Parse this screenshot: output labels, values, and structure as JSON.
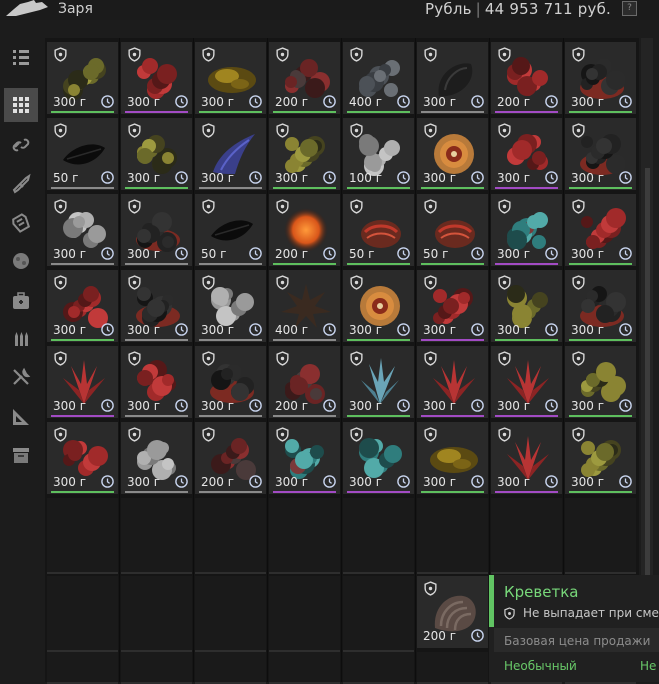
{
  "header": {
    "player_name": "Заря",
    "currency_label": "Рубль",
    "currency_amount": "44 953 711 руб.",
    "help_label": "?"
  },
  "sidebar": {
    "items": [
      {
        "name": "sidebar-item-all",
        "icon": "list-icon",
        "active": false
      },
      {
        "name": "sidebar-item-artifacts",
        "icon": "grid-icon",
        "active": true
      },
      {
        "name": "sidebar-item-containers",
        "icon": "chain-icon",
        "active": false
      },
      {
        "name": "sidebar-item-weapons",
        "icon": "rifle-icon",
        "active": false
      },
      {
        "name": "sidebar-item-armor",
        "icon": "armor-icon",
        "active": false
      },
      {
        "name": "sidebar-item-materials",
        "icon": "sphere-icon",
        "active": false
      },
      {
        "name": "sidebar-item-medicine",
        "icon": "medkit-icon",
        "active": false
      },
      {
        "name": "sidebar-item-ammo",
        "icon": "bullets-icon",
        "active": false
      },
      {
        "name": "sidebar-item-tools",
        "icon": "tools-icon",
        "active": false
      },
      {
        "name": "sidebar-item-drawing",
        "icon": "ruler-icon",
        "active": false
      },
      {
        "name": "sidebar-item-misc",
        "icon": "box-icon",
        "active": false
      }
    ]
  },
  "inventory": {
    "rows": [
      [
        {
          "weight": "300 г",
          "art": "yellow-cluster",
          "rarity": "uncommon"
        },
        {
          "weight": "300 г",
          "art": "red-cluster",
          "rarity": "rare"
        },
        {
          "weight": "300 г",
          "art": "gold-shell",
          "rarity": "uncommon"
        },
        {
          "weight": "200 г",
          "art": "red-rock",
          "rarity": "uncommon"
        },
        {
          "weight": "400 г",
          "art": "grey-cluster",
          "rarity": "uncommon"
        },
        {
          "weight": "300 г",
          "art": "black-shell",
          "rarity": "common"
        },
        {
          "weight": "200 г",
          "art": "red-cluster",
          "rarity": "rare"
        },
        {
          "weight": "300 г",
          "art": "black-red-cluster",
          "rarity": "uncommon"
        }
      ],
      [
        {
          "weight": "50 г",
          "art": "black-leaf",
          "rarity": "common"
        },
        {
          "weight": "300 г",
          "art": "yellow-cluster",
          "rarity": "uncommon"
        },
        {
          "weight": "300 г",
          "art": "blue-claw",
          "rarity": "common"
        },
        {
          "weight": "300 г",
          "art": "yellow-cluster",
          "rarity": "uncommon"
        },
        {
          "weight": "100 г",
          "art": "white-rose",
          "rarity": "uncommon"
        },
        {
          "weight": "300 г",
          "art": "orange-swirl",
          "rarity": "uncommon"
        },
        {
          "weight": "300 г",
          "art": "red-cluster",
          "rarity": "rare"
        },
        {
          "weight": "300 г",
          "art": "black-red-cluster",
          "rarity": "uncommon"
        }
      ],
      [
        {
          "weight": "300 г",
          "art": "white-rose",
          "rarity": "common"
        },
        {
          "weight": "300 г",
          "art": "black-red-cluster",
          "rarity": "common"
        },
        {
          "weight": "50 г",
          "art": "black-leaf",
          "rarity": "common"
        },
        {
          "weight": "200 г",
          "art": "orange-orb",
          "rarity": "uncommon"
        },
        {
          "weight": "50 г",
          "art": "red-shell",
          "rarity": "uncommon"
        },
        {
          "weight": "50 г",
          "art": "red-shell",
          "rarity": "uncommon"
        },
        {
          "weight": "300 г",
          "art": "teal-cluster",
          "rarity": "rare"
        },
        {
          "weight": "300 г",
          "art": "red-cluster",
          "rarity": "uncommon"
        }
      ],
      [
        {
          "weight": "300 г",
          "art": "red-cluster",
          "rarity": "uncommon"
        },
        {
          "weight": "300 г",
          "art": "black-red-cluster",
          "rarity": "common"
        },
        {
          "weight": "300 г",
          "art": "white-rose",
          "rarity": "common"
        },
        {
          "weight": "400 г",
          "art": "brown-spike",
          "rarity": "common"
        },
        {
          "weight": "300 г",
          "art": "orange-swirl",
          "rarity": "uncommon"
        },
        {
          "weight": "300 г",
          "art": "red-cluster",
          "rarity": "rare"
        },
        {
          "weight": "300 г",
          "art": "yellow-cluster",
          "rarity": "uncommon"
        },
        {
          "weight": "300 г",
          "art": "black-red-cluster",
          "rarity": "uncommon"
        }
      ],
      [
        {
          "weight": "300 г",
          "art": "red-crystal",
          "rarity": "rare"
        },
        {
          "weight": "300 г",
          "art": "red-cluster",
          "rarity": "common"
        },
        {
          "weight": "300 г",
          "art": "black-red-cluster",
          "rarity": "common"
        },
        {
          "weight": "200 г",
          "art": "red-rock",
          "rarity": "common"
        },
        {
          "weight": "300 г",
          "art": "ice-crystal",
          "rarity": "uncommon"
        },
        {
          "weight": "300 г",
          "art": "red-crystal",
          "rarity": "rare"
        },
        {
          "weight": "300 г",
          "art": "red-crystal",
          "rarity": "rare"
        },
        {
          "weight": "300 г",
          "art": "yellow-cluster",
          "rarity": "uncommon"
        }
      ],
      [
        {
          "weight": "300 г",
          "art": "red-cluster",
          "rarity": "uncommon"
        },
        {
          "weight": "300 г",
          "art": "white-rose",
          "rarity": "common"
        },
        {
          "weight": "200 г",
          "art": "red-rock",
          "rarity": "common"
        },
        {
          "weight": "300 г",
          "art": "teal-cluster",
          "rarity": "rare"
        },
        {
          "weight": "300 г",
          "art": "teal-cluster",
          "rarity": "rare"
        },
        {
          "weight": "300 г",
          "art": "gold-shell",
          "rarity": "uncommon"
        },
        {
          "weight": "300 г",
          "art": "red-crystal",
          "rarity": "rare"
        },
        {
          "weight": "300 г",
          "art": "yellow-cluster",
          "rarity": "uncommon"
        }
      ]
    ],
    "dragged_item": {
      "weight": "200 г",
      "art": "shrimp"
    }
  },
  "tooltip": {
    "title": "Креветка",
    "no_drop_text": "Не выпадает при смерти",
    "base_price_label": "Базовая цена продажи",
    "rarity_label": "Необычный",
    "right_label": "Не"
  },
  "colors": {
    "common": "#8a8a8a",
    "uncommon": "#5ebf5e",
    "rare": "#a24bc4",
    "accent_green": "#61c463"
  }
}
